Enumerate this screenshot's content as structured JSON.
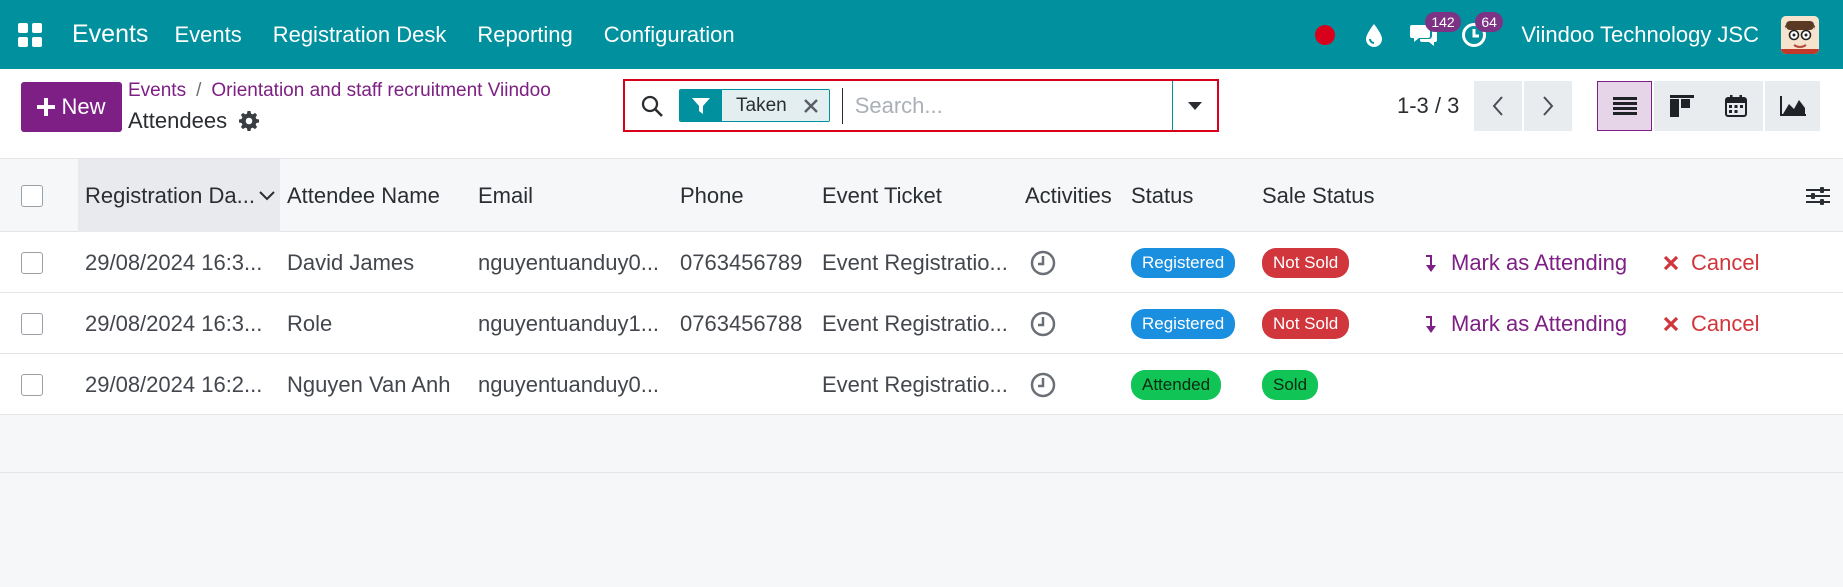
{
  "navbar": {
    "app_name": "Events",
    "menu": [
      "Events",
      "Registration Desk",
      "Reporting",
      "Configuration"
    ],
    "messages_count": "142",
    "activities_count": "64",
    "company": "Viindoo Technology JSC",
    "colors": {
      "bar": "#01909d",
      "badge": "#7d3385",
      "record": "#d9001b"
    }
  },
  "control": {
    "new_label": "New",
    "breadcrumb": [
      "Events",
      "Orientation and staff recruitment Viindoo"
    ],
    "title": "Attendees",
    "search": {
      "facet": "Taken",
      "placeholder": "Search..."
    },
    "pager": "1-3 / 3",
    "views": [
      "list-icon",
      "kanban-icon",
      "calendar-icon",
      "graph-icon"
    ]
  },
  "table": {
    "columns": [
      "Registration Da...",
      "Attendee Name",
      "Email",
      "Phone",
      "Event Ticket",
      "Activities",
      "Status",
      "Sale Status"
    ],
    "rows": [
      {
        "date": "29/08/2024 16:3...",
        "name": "David James",
        "email": "nguyentuanduy0...",
        "phone": "0763456789",
        "ticket": "Event Registratio...",
        "status": "Registered",
        "sale_status": "Not Sold",
        "attend_action": "Mark as Attending",
        "cancel_action": "Cancel"
      },
      {
        "date": "29/08/2024 16:3...",
        "name": "Role",
        "email": "nguyentuanduy1...",
        "phone": "0763456788",
        "ticket": "Event Registratio...",
        "status": "Registered",
        "sale_status": "Not Sold",
        "attend_action": "Mark as Attending",
        "cancel_action": "Cancel"
      },
      {
        "date": "29/08/2024 16:2...",
        "name": "Nguyen Van Anh",
        "email": "nguyentuanduy0...",
        "phone": "",
        "ticket": "Event Registratio...",
        "status": "Attended",
        "sale_status": "Sold",
        "attend_action": "",
        "cancel_action": ""
      }
    ],
    "colors": {
      "registered": "#1a8fe0",
      "not_sold": "#d0363c",
      "attended": "#10c455",
      "sold": "#10c455"
    }
  }
}
